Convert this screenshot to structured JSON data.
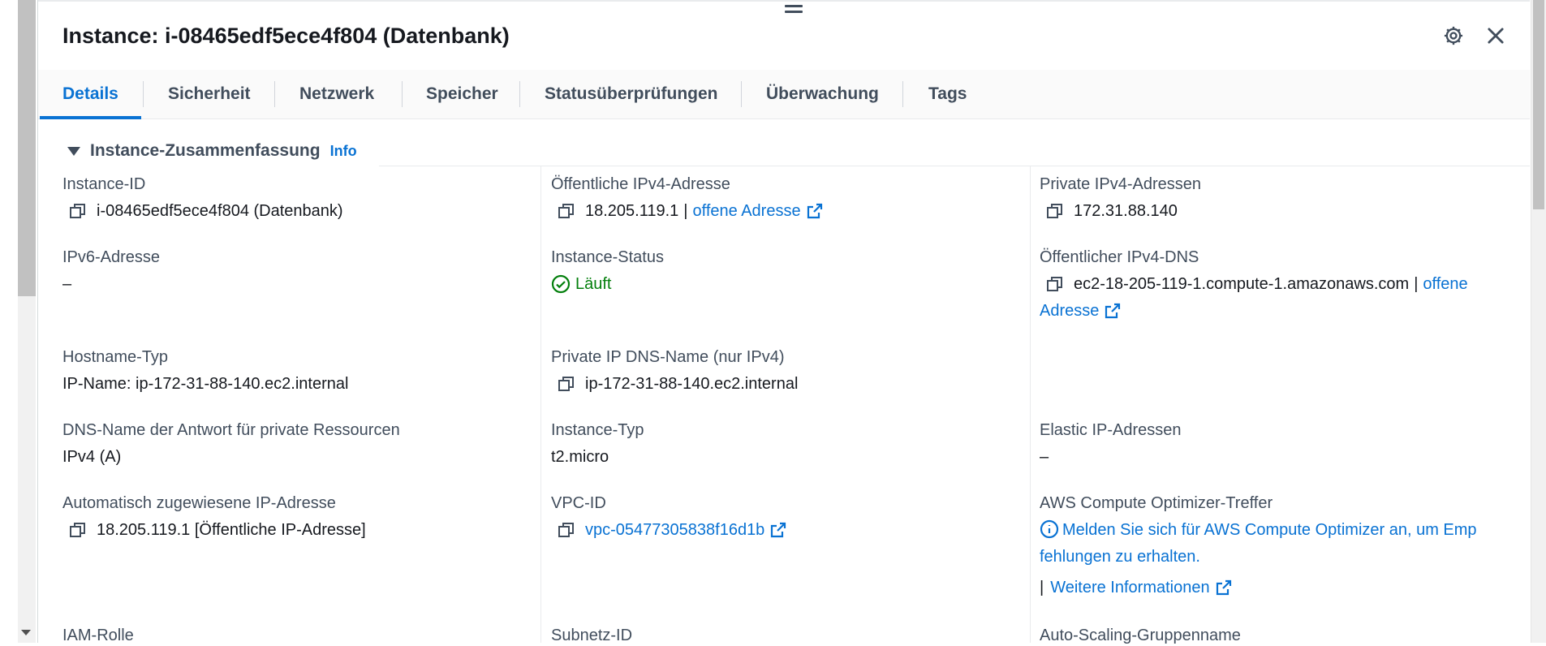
{
  "title": "Instance: i-08465edf5ece4f804 (Datenbank)",
  "colors": {
    "link": "#0972d3",
    "ok": "#037f0c",
    "text": "#16191f",
    "label": "#414d5c"
  },
  "tabs": [
    {
      "label": "Details"
    },
    {
      "label": "Sicherheit"
    },
    {
      "label": "Netzwerk"
    },
    {
      "label": "Speicher"
    },
    {
      "label": "Statusüberprüfungen"
    },
    {
      "label": "Überwachung"
    },
    {
      "label": "Tags"
    }
  ],
  "section": {
    "title": "Instance-Zusammenfassung",
    "info": "Info"
  },
  "fields": {
    "instance_id": {
      "label": "Instance-ID",
      "value": "i-08465edf5ece4f804 (Datenbank)"
    },
    "public_ipv4": {
      "label": "Öffentliche IPv4-Adresse",
      "value": "18.205.119.1",
      "sep": "|",
      "link": "offene Adresse"
    },
    "private_ipv4": {
      "label": "Private IPv4-Adressen",
      "value": "172.31.88.140"
    },
    "ipv6": {
      "label": "IPv6-Adresse",
      "value": "–"
    },
    "state": {
      "label": "Instance-Status",
      "value": "Läuft"
    },
    "public_dns": {
      "label": "Öffentlicher IPv4-DNS",
      "value": "ec2-18-205-119-1.compute-1.amazonaws.com",
      "sep": "|",
      "link_part1": "offene",
      "link_part2": "Adresse"
    },
    "hostname_type": {
      "label": "Hostname-Typ",
      "value": "IP-Name: ip-172-31-88-140.ec2.internal"
    },
    "private_dns": {
      "label": "Private IP DNS-Name (nur IPv4)",
      "value": "ip-172-31-88-140.ec2.internal"
    },
    "answer_dns": {
      "label": "DNS-Name der Antwort für private Ressourcen",
      "value": "IPv4 (A)"
    },
    "instance_type": {
      "label": "Instance-Typ",
      "value": "t2.micro"
    },
    "elastic_ip": {
      "label": "Elastic IP-Adressen",
      "value": "–"
    },
    "auto_ip": {
      "label": "Automatisch zugewiesene IP-Adresse",
      "value": "18.205.119.1 [Öffentliche IP-Adresse]"
    },
    "vpc": {
      "label": "VPC-ID",
      "value": "vpc-05477305838f16d1b"
    },
    "optimizer": {
      "label": "AWS Compute Optimizer-Treffer",
      "line1": "Melden Sie sich für AWS Compute Optimizer an, um Emp",
      "line2": "fehlungen zu erhalten.",
      "sep": "|",
      "more": "Weitere Informationen"
    },
    "iam": {
      "label": "IAM-Rolle"
    },
    "subnet": {
      "label": "Subnetz-ID"
    },
    "asg": {
      "label": "Auto-Scaling-Gruppenname"
    }
  }
}
